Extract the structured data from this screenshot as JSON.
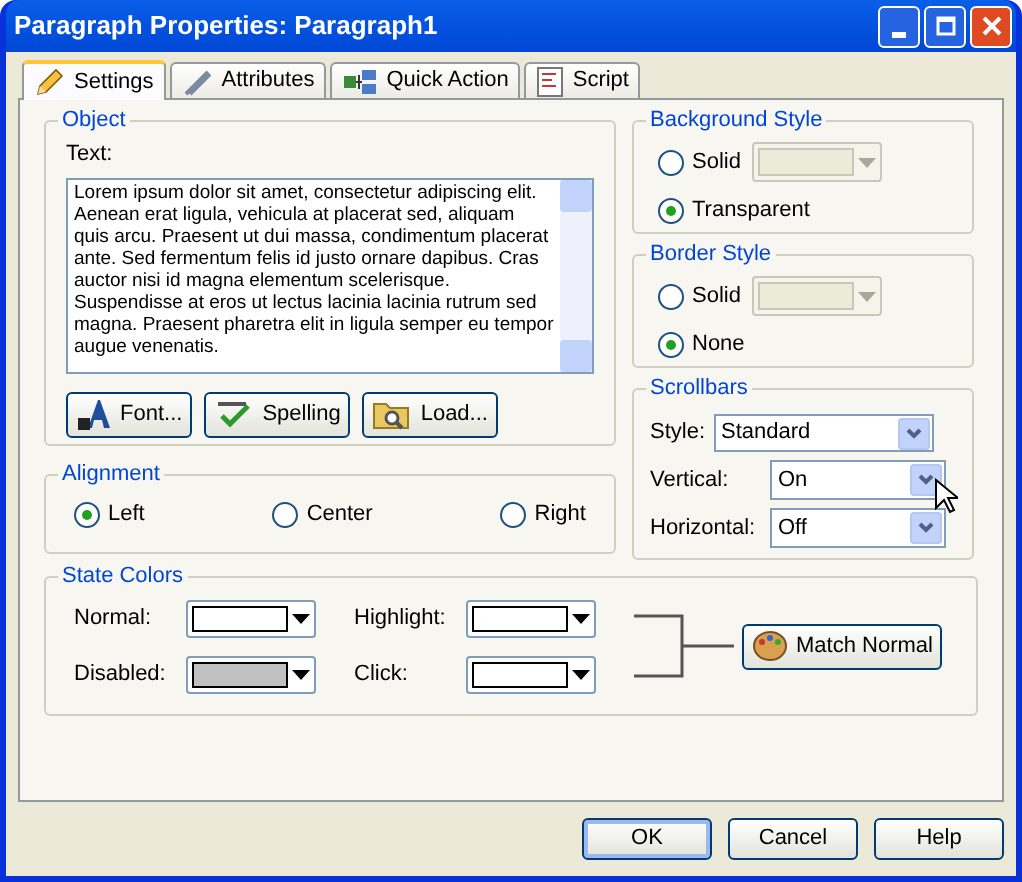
{
  "window": {
    "title": "Paragraph Properties: Paragraph1"
  },
  "tabs": [
    {
      "label": "Settings",
      "kind": "pencil",
      "selected": true
    },
    {
      "label": "Attributes",
      "kind": "tools",
      "selected": false
    },
    {
      "label": "Quick Action",
      "kind": "blocks",
      "selected": false
    },
    {
      "label": "Script",
      "kind": "script",
      "selected": false
    }
  ],
  "object": {
    "title": "Object",
    "text_label": "Text:",
    "text": "Lorem ipsum dolor sit amet, consectetur adipiscing elit. Aenean erat ligula, vehicula at placerat sed, aliquam quis arcu. Praesent ut dui massa, condimentum placerat ante. Sed fermentum felis id justo ornare dapibus. Cras auctor nisi id magna elementum scelerisque. Suspendisse at eros ut lectus lacinia lacinia rutrum sed magna. Praesent pharetra elit in ligula semper eu tempor augue venenatis.",
    "buttons": [
      {
        "label": "Font...",
        "kind": "font"
      },
      {
        "label": "Spelling",
        "kind": "spell"
      },
      {
        "label": "Load...",
        "kind": "folder"
      }
    ]
  },
  "alignment": {
    "title": "Alignment",
    "options": [
      {
        "label": "Left",
        "selected": true
      },
      {
        "label": "Center",
        "selected": false
      },
      {
        "label": "Right",
        "selected": false
      }
    ]
  },
  "background_style": {
    "title": "Background Style",
    "options": [
      {
        "label": "Solid",
        "selected": false
      },
      {
        "label": "Transparent",
        "selected": true
      }
    ],
    "color_disabled": true
  },
  "border_style": {
    "title": "Border Style",
    "options": [
      {
        "label": "Solid",
        "selected": false
      },
      {
        "label": "None",
        "selected": true
      }
    ],
    "color_disabled": true
  },
  "scrollbars": {
    "title": "Scrollbars",
    "fields": [
      {
        "label": "Style:",
        "value": "Standard"
      },
      {
        "label": "Vertical:",
        "value": "On"
      },
      {
        "label": "Horizontal:",
        "value": "Off"
      }
    ]
  },
  "state_colors": {
    "title": "State Colors",
    "items": [
      {
        "label": "Normal:",
        "color": "#ffffff"
      },
      {
        "label": "Highlight:",
        "color": "#ffffff"
      },
      {
        "label": "Disabled:",
        "color": "#c0c0c0"
      },
      {
        "label": "Click:",
        "color": "#ffffff"
      }
    ],
    "match_button": "Match Normal"
  },
  "buttons": [
    {
      "label": "OK",
      "default": true
    },
    {
      "label": "Cancel",
      "default": false
    },
    {
      "label": "Help",
      "default": false
    }
  ]
}
